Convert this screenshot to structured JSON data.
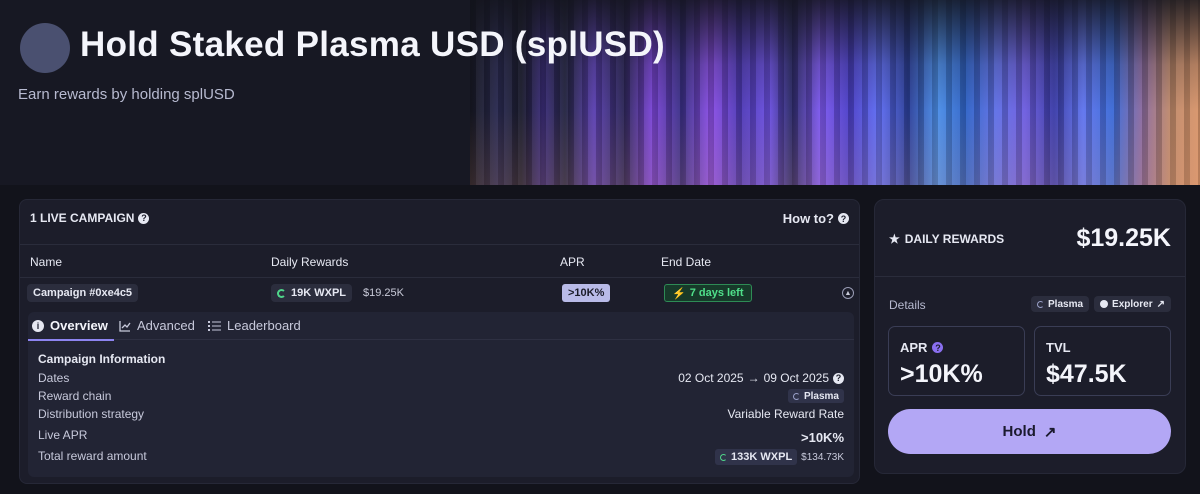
{
  "hero": {
    "title": "Hold Staked Plasma USD (splUSD)",
    "subtitle": "Earn rewards by holding splUSD"
  },
  "campaigns": {
    "header": "1 LIVE CAMPAIGN",
    "how_to": "How to?",
    "columns": [
      "Name",
      "Daily Rewards",
      "APR",
      "End Date"
    ],
    "row": {
      "name": "Campaign #0xe4c5",
      "reward_amount": "19K WXPL",
      "reward_usd": "$19.25K",
      "apr": ">10K%",
      "end_date": "7 days left"
    },
    "tabs": [
      "Overview",
      "Advanced",
      "Leaderboard"
    ],
    "info": {
      "section_title": "Campaign Information",
      "dates_label": "Dates",
      "dates_start": "02 Oct 2025",
      "dates_end": "09 Oct 2025",
      "chain_label": "Reward chain",
      "chain_value": "Plasma",
      "strategy_label": "Distribution strategy",
      "strategy_value": "Variable Reward Rate",
      "apr_label": "Live APR",
      "apr_value": ">10K%",
      "total_label": "Total reward amount",
      "total_amount": "133K WXPL",
      "total_usd": "$134.73K"
    }
  },
  "summary": {
    "daily_rewards_label": "DAILY REWARDS",
    "daily_rewards_value": "$19.25K",
    "details_label": "Details",
    "chain_chip": "Plasma",
    "explorer_chip": "Explorer",
    "apr_label": "APR",
    "apr_value": ">10K%",
    "tvl_label": "TVL",
    "tvl_value": "$47.5K",
    "hold_button": "Hold"
  }
}
